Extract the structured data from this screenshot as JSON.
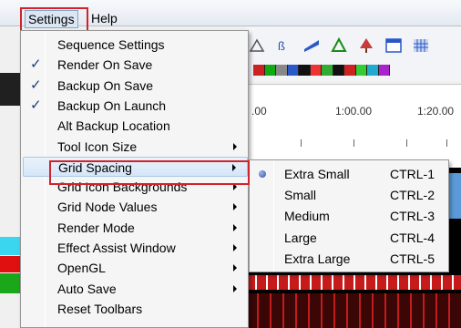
{
  "menubar": {
    "items": [
      "Settings",
      "Help"
    ]
  },
  "timeline": {
    "labels": [
      ".00",
      "1:00.00",
      "1:20.00"
    ]
  },
  "settings_menu": {
    "items": [
      {
        "label": "Sequence Settings",
        "checked": false,
        "submenu": false
      },
      {
        "label": "Render On Save",
        "checked": true,
        "submenu": false
      },
      {
        "label": "Backup On Save",
        "checked": true,
        "submenu": false
      },
      {
        "label": "Backup On Launch",
        "checked": true,
        "submenu": false
      },
      {
        "label": "Alt Backup Location",
        "checked": false,
        "submenu": false
      },
      {
        "label": "Tool Icon Size",
        "checked": false,
        "submenu": true
      },
      {
        "label": "Grid Spacing",
        "checked": false,
        "submenu": true,
        "active": true
      },
      {
        "label": "Grid Icon Backgrounds",
        "checked": false,
        "submenu": true
      },
      {
        "label": "Grid Node Values",
        "checked": false,
        "submenu": true
      },
      {
        "label": "Render Mode",
        "checked": false,
        "submenu": true
      },
      {
        "label": "Effect Assist Window",
        "checked": false,
        "submenu": true
      },
      {
        "label": "OpenGL",
        "checked": false,
        "submenu": true
      },
      {
        "label": "Auto Save",
        "checked": false,
        "submenu": true
      },
      {
        "label": "Reset Toolbars",
        "checked": false,
        "submenu": false
      }
    ]
  },
  "grid_spacing_menu": {
    "items": [
      {
        "label": "Extra Small",
        "shortcut": "CTRL-1",
        "selected": true
      },
      {
        "label": "Small",
        "shortcut": "CTRL-2",
        "selected": false
      },
      {
        "label": "Medium",
        "shortcut": "CTRL-3",
        "selected": false
      },
      {
        "label": "Large",
        "shortcut": "CTRL-4",
        "selected": false
      },
      {
        "label": "Extra Large",
        "shortcut": "CTRL-5",
        "selected": false
      }
    ]
  },
  "colors": {
    "highlight_box": "#d0232a",
    "check": "#1b3c7a"
  },
  "check_glyph": "✓"
}
